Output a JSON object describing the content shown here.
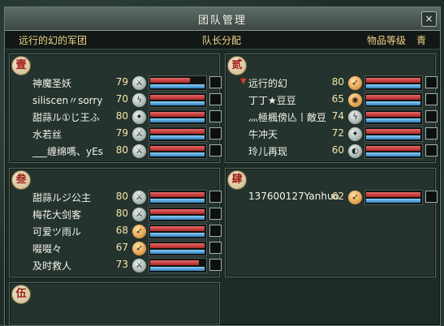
{
  "window": {
    "title": "团队管理",
    "close_label": "×"
  },
  "header": {
    "team_name": "远行的幻的军团",
    "assign_label": "队长分配",
    "item_level_label": "物品等级",
    "item_level_value": "青"
  },
  "groups": [
    {
      "badge": "壹",
      "members": [
        {
          "name": "神魔圣妖",
          "level": "79",
          "icon": "warrior-icon",
          "hp": 0.72,
          "mp": 0.98,
          "leader": false
        },
        {
          "name": "siliscen〃sorry",
          "level": "70",
          "icon": "claw-icon",
          "hp": 0.98,
          "mp": 0.98,
          "leader": false
        },
        {
          "name": "甜蒜ル①じ王ふ",
          "level": "80",
          "icon": "mage-icon",
          "hp": 0.98,
          "mp": 0.98,
          "leader": false
        },
        {
          "name": "水若丝",
          "level": "79",
          "icon": "warrior-icon",
          "hp": 0.98,
          "mp": 0.98,
          "leader": false
        },
        {
          "name": "___缠绵嗎、yEs",
          "level": "80",
          "icon": "warrior-icon",
          "hp": 0.98,
          "mp": 0.98,
          "leader": false
        }
      ]
    },
    {
      "badge": "贰",
      "members": [
        {
          "name": "远行的幻",
          "level": "80",
          "icon": "archer-icon",
          "hp": 0.98,
          "mp": 0.98,
          "leader": true
        },
        {
          "name": "丁丁★豆豆",
          "level": "65",
          "icon": "beast-icon",
          "hp": 0.98,
          "mp": 0.98,
          "leader": false
        },
        {
          "name": "灬極楓傍亾丨敵豆",
          "level": "74",
          "icon": "claw-icon",
          "hp": 0.98,
          "mp": 0.98,
          "leader": false
        },
        {
          "name": "牛冲天",
          "level": "72",
          "icon": "mage-icon",
          "hp": 0.98,
          "mp": 0.98,
          "leader": false
        },
        {
          "name": "玲儿再现",
          "level": "60",
          "icon": "fan-icon",
          "hp": 0.98,
          "mp": 0.98,
          "leader": false
        }
      ]
    },
    {
      "badge": "叁",
      "members": [
        {
          "name": "甜蒜ルジ公主",
          "level": "80",
          "icon": "warrior-icon",
          "hp": 0.98,
          "mp": 0.98,
          "leader": false
        },
        {
          "name": "梅花大剑客",
          "level": "80",
          "icon": "warrior-icon",
          "hp": 0.98,
          "mp": 0.98,
          "leader": false
        },
        {
          "name": "可爱ツ雨ル",
          "level": "68",
          "icon": "archer-icon",
          "hp": 0.98,
          "mp": 0.98,
          "leader": false
        },
        {
          "name": "啜啜々",
          "level": "67",
          "icon": "archer-icon",
          "hp": 0.98,
          "mp": 0.98,
          "leader": false
        },
        {
          "name": "及时救人",
          "level": "73",
          "icon": "warrior-icon",
          "hp": 0.88,
          "mp": 0.98,
          "leader": false
        }
      ]
    },
    {
      "badge": "肆",
      "members": [
        {
          "name": "137600127Yanhuo",
          "level": "62",
          "icon": "archer-icon",
          "hp": 0.98,
          "mp": 0.98,
          "leader": false
        }
      ]
    },
    {
      "badge": "伍",
      "members": []
    }
  ]
}
